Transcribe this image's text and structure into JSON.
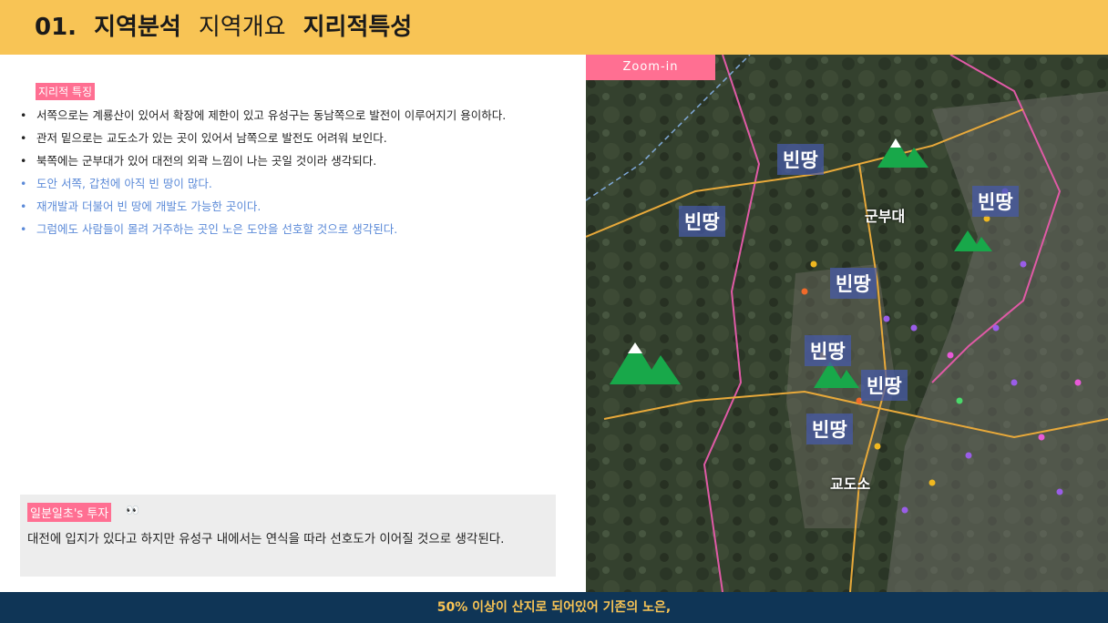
{
  "header": {
    "number": "01.",
    "part1": "지역분석",
    "part2": "지역개요",
    "part3": "지리적특성"
  },
  "section": {
    "tag": "지리적 특징",
    "bullets": [
      "서쪽으로는 계룡산이 있어서 확장에 제한이 있고 유성구는 동남쪽으로 발전이 이루어지기 용이하다.",
      "관저 밑으로는 교도소가 있는 곳이 있어서 남쪽으로 발전도 어려워 보인다.",
      "북쪽에는 군부대가 있어 대전의 외곽 느낌이 나는 곳일 것이라 생각되다.",
      "도안 서쪽, 갑천에 아직 빈 땅이 많다.",
      "재개발과 더불어 빈 땅에 개발도 가능한 곳이다.",
      "그럼에도 사람들이 몰려 거주하는 곳인 노은 도안을 선호할 것으로 생각된다."
    ]
  },
  "note": {
    "tag": "일분일초's 투자",
    "emoji": "👀",
    "text": "대전에 입지가 있다고 하지만 유성구 내에서는 연식을 따라 선호도가 이어질 것으로 생각된다."
  },
  "map": {
    "zoom_label": "Zoom-in",
    "labels": [
      "빈땅",
      "빈땅",
      "빈땅",
      "빈땅",
      "빈땅",
      "빈땅",
      "빈땅"
    ],
    "base_label": "군부대",
    "prison_label": "교도소"
  },
  "footer": {
    "text": "50% 이상이 산지로 되어있어 기존의 노은,"
  },
  "colors": {
    "header_bg": "#f8c455",
    "accent_pink": "#ff6f92",
    "footer_bg": "#0f3556",
    "bullet_blue": "#5b8ad8",
    "mountain_green": "#18a84a"
  }
}
